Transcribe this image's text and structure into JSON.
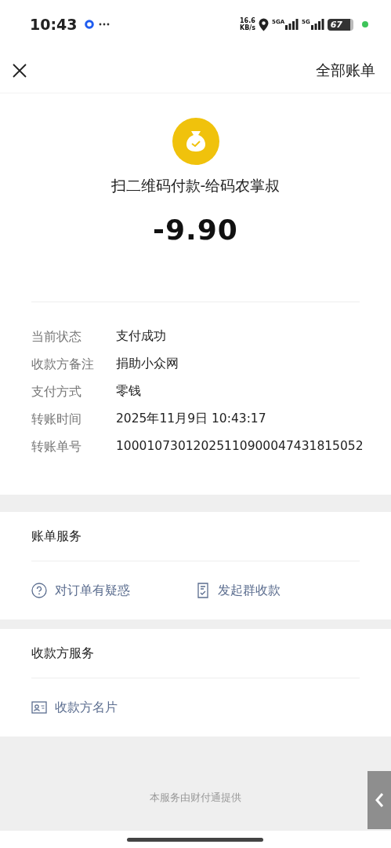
{
  "status_bar": {
    "time": "10:43",
    "speed_value": "16.6",
    "speed_unit": "KB/s",
    "network_1": "5GA",
    "network_2": "5G",
    "battery": "67"
  },
  "header": {
    "link": "全部账单"
  },
  "payment": {
    "title": "扫二维码付款-给码农掌叔",
    "amount": "-9.90"
  },
  "details": [
    {
      "label": "当前状态",
      "value": "支付成功"
    },
    {
      "label": "收款方备注",
      "value": "捐助小众网"
    },
    {
      "label": "支付方式",
      "value": "零钱"
    },
    {
      "label": "转账时间",
      "value": "2025年11月9日 10:43:17"
    },
    {
      "label": "转账单号",
      "value": "10001073012025110900047431815052"
    }
  ],
  "sections": [
    {
      "title": "账单服务",
      "actions": [
        {
          "kind": "question",
          "label": "对订单有疑惑"
        },
        {
          "kind": "receipt",
          "label": "发起群收款"
        }
      ]
    },
    {
      "title": "收款方服务",
      "actions": [
        {
          "kind": "card",
          "label": "收款方名片"
        }
      ]
    }
  ],
  "footer": {
    "text": "本服务由财付通提供"
  }
}
